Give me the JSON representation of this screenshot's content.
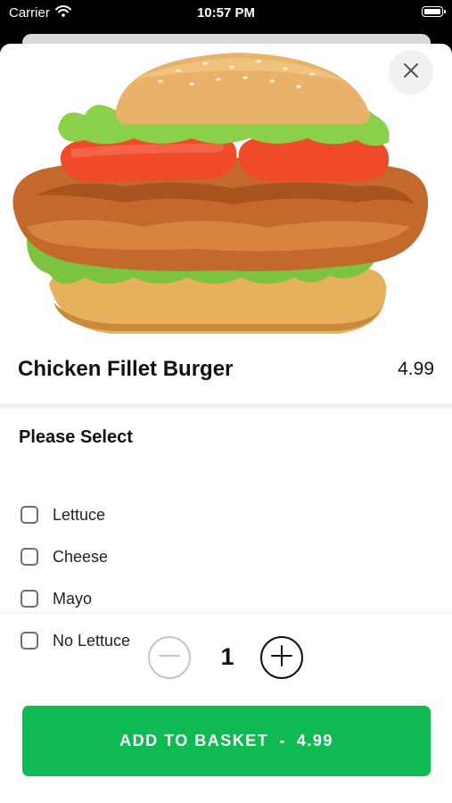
{
  "status_bar": {
    "carrier": "Carrier",
    "time": "10:57 PM"
  },
  "product": {
    "name": "Chicken Fillet Burger",
    "price": "4.99"
  },
  "options": {
    "title": "Please Select",
    "items": [
      {
        "label": "Lettuce",
        "checked": false
      },
      {
        "label": "Cheese",
        "checked": false
      },
      {
        "label": "Mayo",
        "checked": false
      },
      {
        "label": "No Lettuce",
        "checked": false
      }
    ]
  },
  "quantity": {
    "value": "1"
  },
  "add_button": {
    "label": "ADD TO BASKET",
    "separator": "-",
    "price": "4.99"
  },
  "colors": {
    "accent": "#0fba53",
    "sheet": "#ffffff",
    "background": "#000000"
  }
}
